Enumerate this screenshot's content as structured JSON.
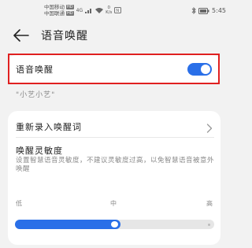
{
  "status_bar": {
    "carrier1": "中国移动",
    "carrier2": "中国联通",
    "hd1": "HD",
    "hd2": "HD",
    "net_type": "4G",
    "speed_value": "0",
    "speed_unit": "K/s",
    "nfc_badge": "N",
    "battery": "",
    "time": "5:45"
  },
  "app_bar": {
    "back_icon": "arrow-left-icon",
    "title": "语音唤醒"
  },
  "wake_toggle": {
    "label": "语音唤醒",
    "enabled": true,
    "color": "#2a6fe8"
  },
  "hint": "\"小艺小艺\"",
  "settings": {
    "re_enroll_label": "重新录入唤醒词",
    "sensitivity_title": "唤醒灵敏度",
    "sensitivity_desc": "设置智慧语音灵敏度，不建议灵敏度过高，以免智慧语音被意外唤醒",
    "ticks": {
      "low": "低",
      "mid": "中",
      "high": "高"
    },
    "slider_value_percent": 53
  },
  "colors": {
    "accent": "#2a6fe8",
    "highlight_border": "#e02020"
  }
}
